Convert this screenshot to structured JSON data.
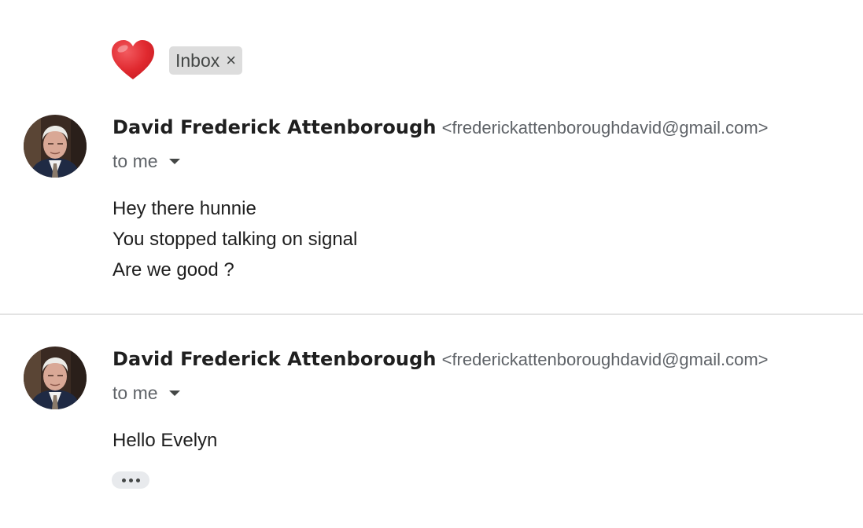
{
  "thread": {
    "importance_icon": "heart-icon",
    "label": {
      "text": "Inbox",
      "remove_glyph": "×"
    }
  },
  "messages": [
    {
      "sender_name": "David Frederick Attenborough",
      "sender_email": "<frederickattenboroughdavid@gmail.com>",
      "recipient": "to me",
      "body_lines": [
        "Hey there hunnie",
        "You stopped talking on signal",
        "Are we good ?"
      ]
    },
    {
      "sender_name": "David Frederick Attenborough",
      "sender_email": "<frederickattenboroughdavid@gmail.com>",
      "recipient": "to me",
      "body_lines": [
        "Hello Evelyn"
      ],
      "trimmed_content_icon": "more-horizontal-icon"
    }
  ],
  "colors": {
    "heart": "#e0292f",
    "chip_background": "#dddddd",
    "divider": "#e3e3e3",
    "secondary_text": "#5f6368"
  }
}
